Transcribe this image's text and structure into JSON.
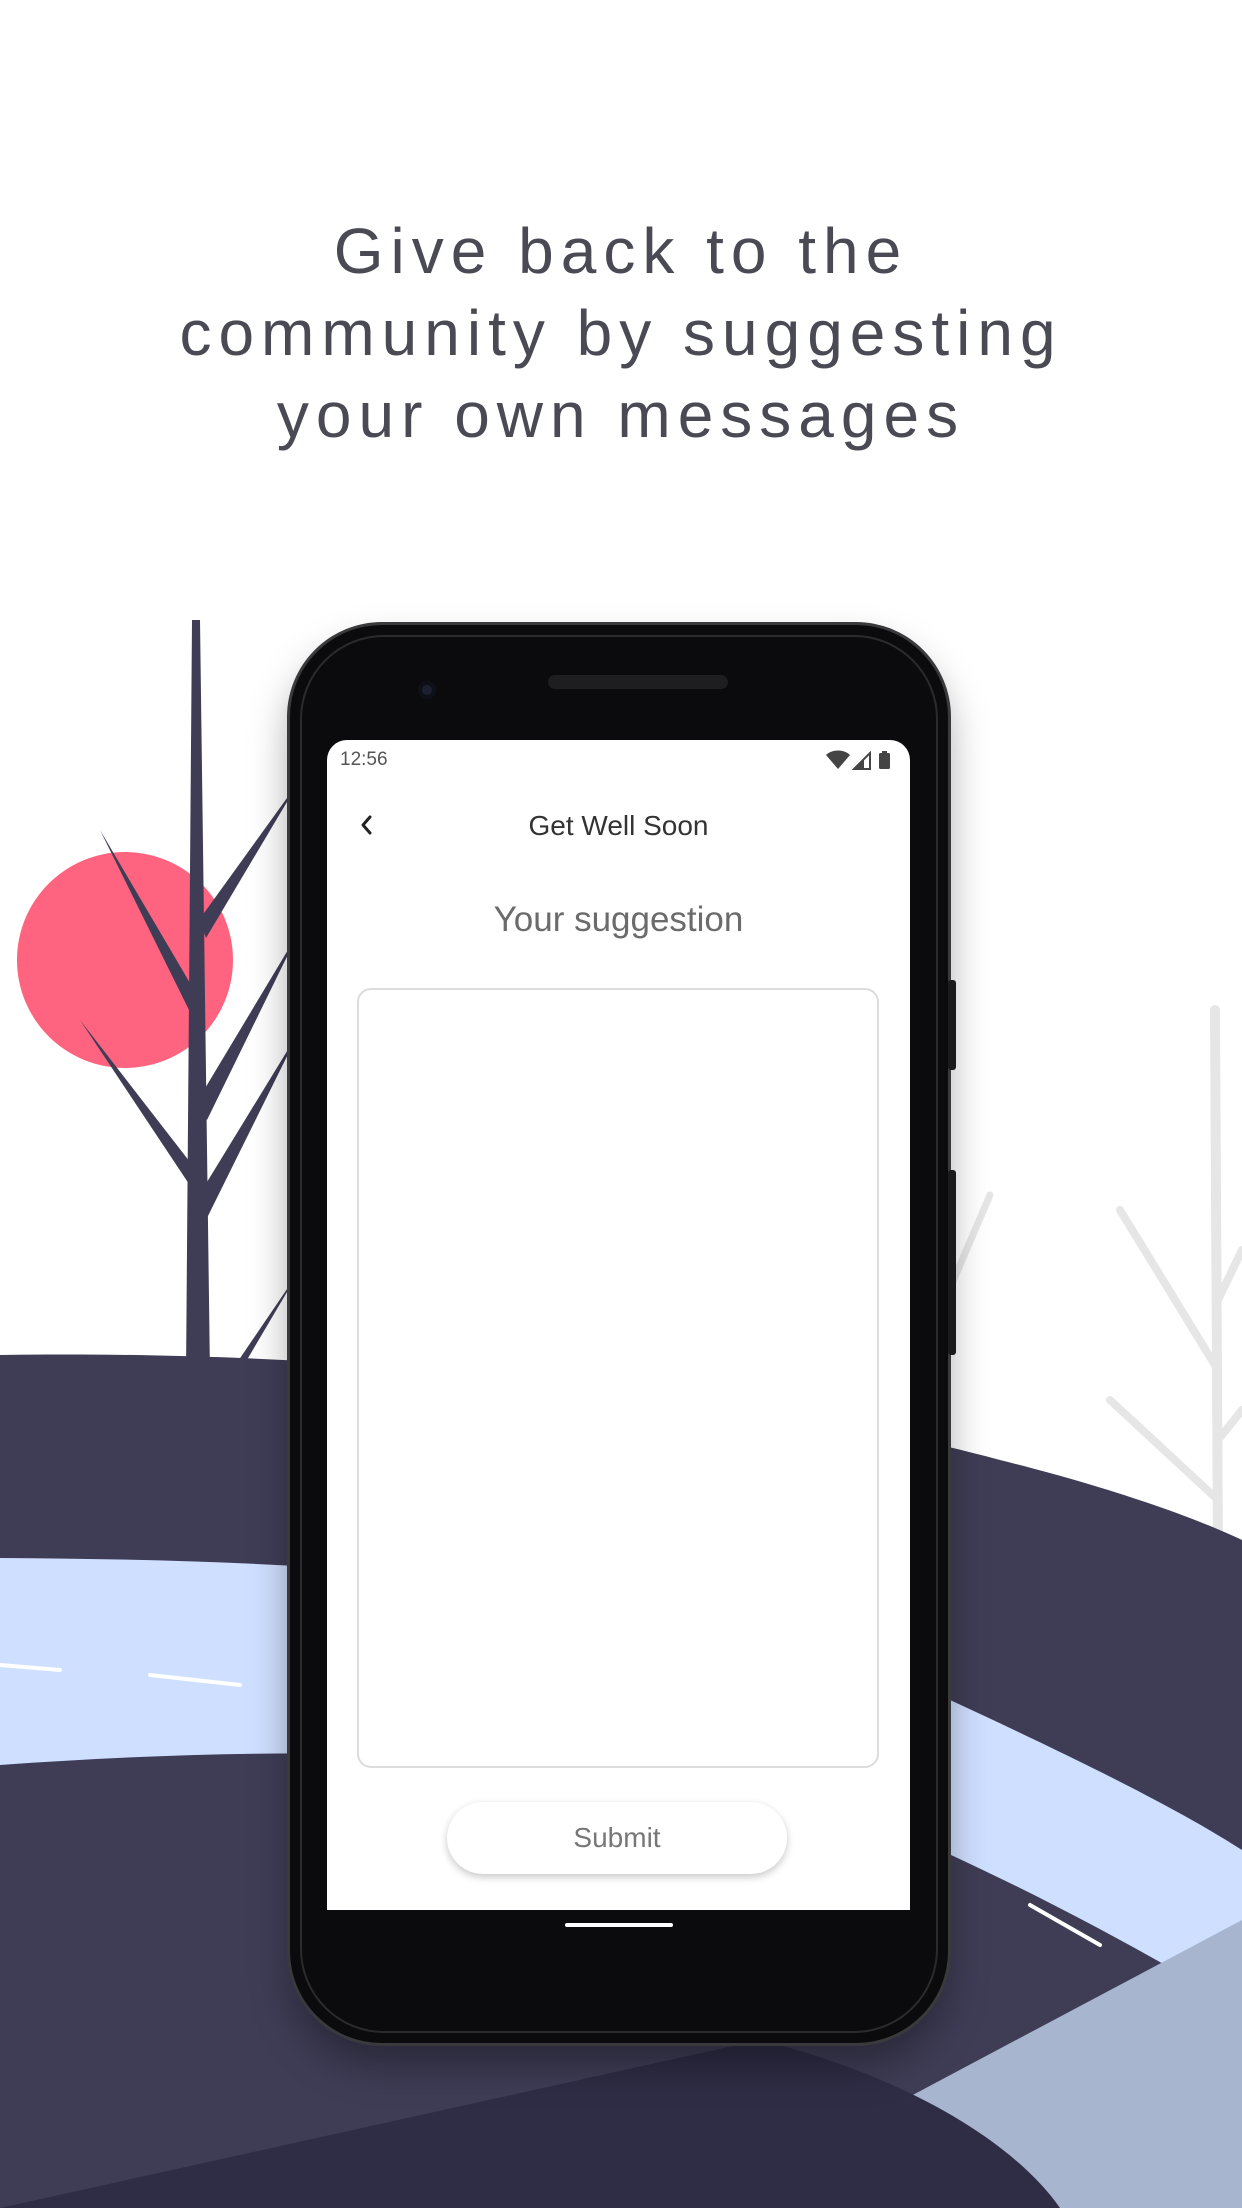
{
  "headline": {
    "line1": "Give back to the",
    "line2": "community by suggesting",
    "line3": "your own messages"
  },
  "colors": {
    "sun": "#fe647f",
    "hill": "#3f3d56",
    "river": "#cfdfff",
    "tree_light": "#e6e6e6"
  },
  "status_bar": {
    "time": "12:56",
    "icons": [
      "wifi-icon",
      "signal-icon",
      "battery-icon"
    ]
  },
  "app_bar": {
    "back_icon": "chevron-left-icon",
    "title": "Get Well Soon"
  },
  "form": {
    "label": "Your suggestion",
    "input_value": "",
    "submit_label": "Submit"
  }
}
